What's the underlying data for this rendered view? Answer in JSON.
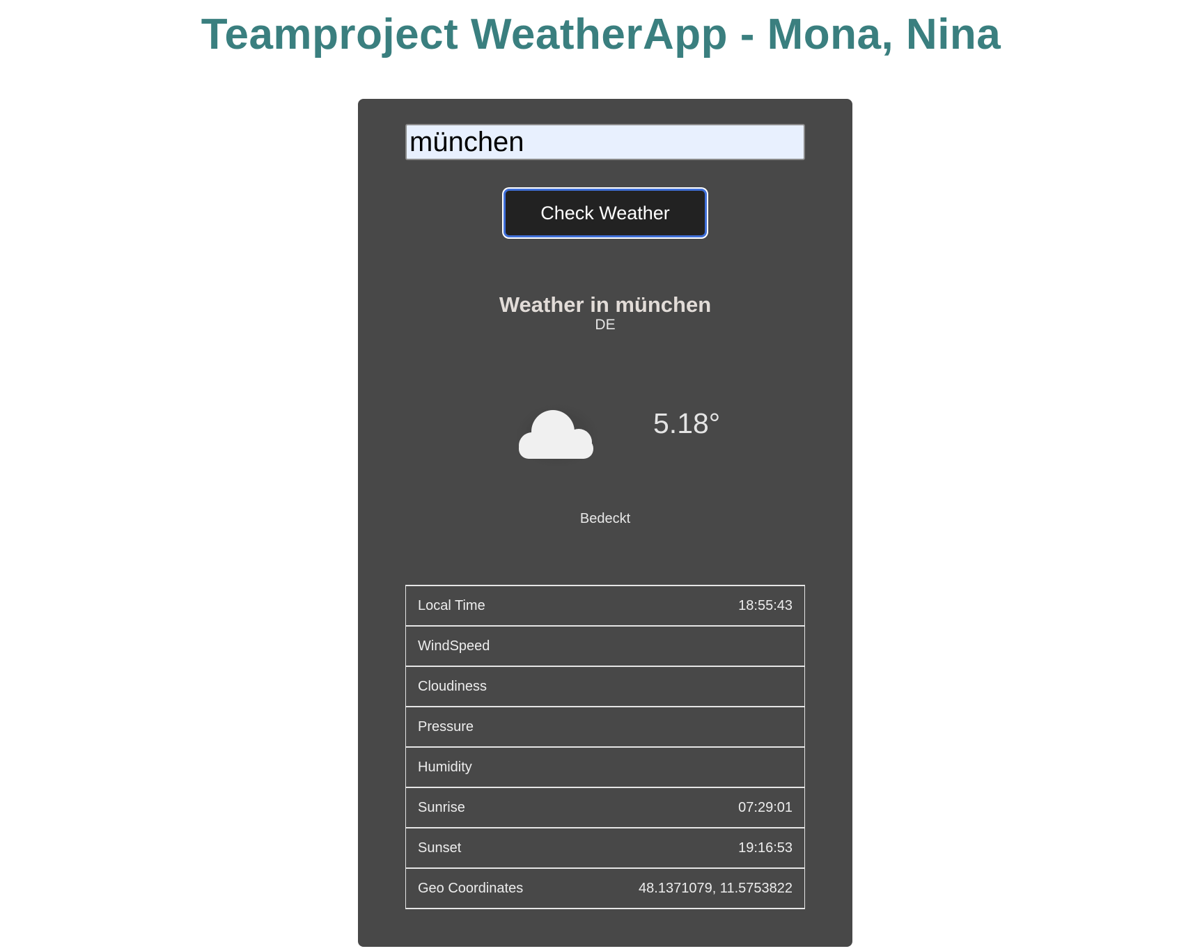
{
  "header": {
    "title": "Teamproject WeatherApp - Mona, Nina"
  },
  "search": {
    "value": "münchen"
  },
  "actions": {
    "check_label": "Check Weather"
  },
  "weather": {
    "heading": "Weather in münchen",
    "country": "DE",
    "icon": "cloud-icon",
    "temperature": "5.18°",
    "description": "Bedeckt"
  },
  "details": [
    {
      "label": "Local Time",
      "value": "18:55:43"
    },
    {
      "label": "WindSpeed",
      "value": ""
    },
    {
      "label": "Cloudiness",
      "value": ""
    },
    {
      "label": "Pressure",
      "value": ""
    },
    {
      "label": "Humidity",
      "value": ""
    },
    {
      "label": "Sunrise",
      "value": "07:29:01"
    },
    {
      "label": "Sunset",
      "value": "19:16:53"
    },
    {
      "label": "Geo Coordinates",
      "value": "48.1371079, 11.5753822"
    }
  ],
  "colors": {
    "title": "#3a7f7f",
    "card_background": "#484848",
    "input_background": "#e8f0fe",
    "button_background": "#222222",
    "button_focus_border": "#3f6fd8"
  }
}
